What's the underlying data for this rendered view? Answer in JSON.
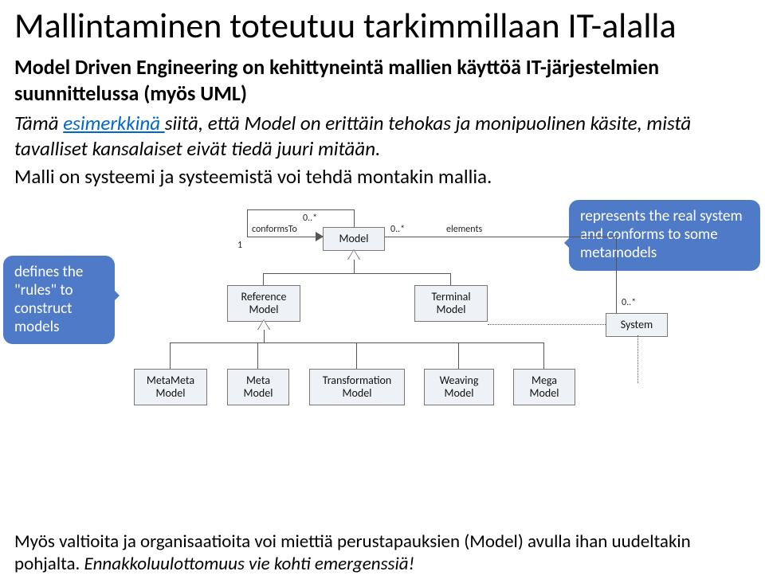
{
  "title": "Mallintaminen toteutuu tarkimmillaan IT-alalla",
  "subtitle": "Model Driven Engineering on kehittyneintä mallien käyttöä IT-järjestelmien suunnittelussa (myös UML)",
  "body1_pre": "Tämä ",
  "body1_link": "esimerkkinä ",
  "body1_post": "siitä, että Model on erittäin tehokas ja monipuolinen käsite, mistä tavalliset kansalaiset eivät tiedä juuri mitään.",
  "body2": "Malli on systeemi ja systeemistä voi tehdä montakin mallia.",
  "callout_left": "defines the \"rules\" to construct models",
  "callout_right": "represents the real system and conforms to some metamodels",
  "uml": {
    "model": "Model",
    "system": "System",
    "reference": "Reference\nModel",
    "terminal": "Terminal\nModel",
    "metameta": "MetaMeta\nModel",
    "meta": "Meta\nModel",
    "transformation": "Transformation\nModel",
    "weaving": "Weaving\nModel",
    "mega": "Mega\nModel",
    "conformsTo": "conformsTo",
    "elements": "elements",
    "m1": "1",
    "m0s": "0..*",
    "m0s2": "0..*",
    "m0s3": "0..*"
  },
  "footer_main": "Myös valtioita ja organisaatioita voi miettiä perustapauksien (Model) avulla ihan uudeltakin pohjalta. ",
  "footer_em": "Ennakkoluulottomuus vie kohti emergenssiä!"
}
